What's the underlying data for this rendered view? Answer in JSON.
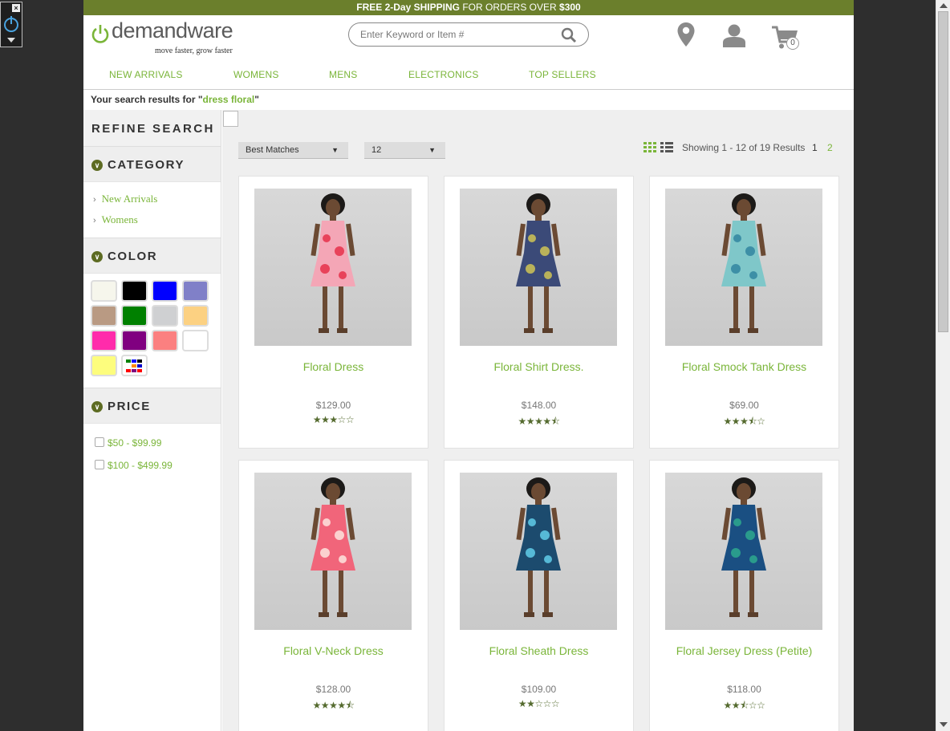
{
  "promo": {
    "pre": "FREE 2-Day",
    "b1": "SHIPPING",
    "post": "FOR ORDERS OVER",
    "amount": "$300"
  },
  "logo": {
    "word": "demandware",
    "tagline": "move faster, grow faster"
  },
  "search": {
    "placeholder": "Enter Keyword or Item #"
  },
  "header": {
    "cart_count": "0"
  },
  "nav": [
    "NEW ARRIVALS",
    "WOMENS",
    "MENS",
    "ELECTRONICS",
    "TOP SELLERS"
  ],
  "results": {
    "prefix": "Your search results for \"",
    "term": "dress floral",
    "suffix": "\""
  },
  "sidebar": {
    "refine": "REFINE SEARCH",
    "category_title": "CATEGORY",
    "categories": [
      "New Arrivals",
      "Womens"
    ],
    "color_title": "COLOR",
    "colors": [
      "#f6f6ec",
      "#000000",
      "#0000ff",
      "#8080c8",
      "#b99a83",
      "#008000",
      "#cfd0d2",
      "#fcd182",
      "#ff2bab",
      "#800080",
      "#fb8080",
      "#ffffff",
      "#fdfd7d",
      "multi"
    ],
    "price_title": "PRICE",
    "prices": [
      "$50 - $99.99",
      "$100 - $499.99"
    ]
  },
  "toolbar": {
    "sort": "Best Matches",
    "per_page": "12",
    "showing": "Showing 1 - 12 of 19 Results",
    "pages": [
      "1",
      "2"
    ]
  },
  "products": [
    {
      "name": "Floral Dress",
      "price": "$129.00",
      "rating": 3,
      "dress": "#f4a6b6",
      "accent": "#e8425a"
    },
    {
      "name": "Floral Shirt Dress.",
      "price": "$148.00",
      "rating": 4.5,
      "dress": "#3b4a78",
      "accent": "#b9b25a"
    },
    {
      "name": "Floral Smock Tank Dress",
      "price": "$69.00",
      "rating": 3.5,
      "dress": "#7fc7c9",
      "accent": "#3d8fa6"
    },
    {
      "name": "Floral V-Neck Dress",
      "price": "$128.00",
      "rating": 4.5,
      "dress": "#f1657a",
      "accent": "#fbd1cf"
    },
    {
      "name": "Floral Sheath Dress",
      "price": "$109.00",
      "rating": 2,
      "dress": "#1c4b6e",
      "accent": "#56b9d6"
    },
    {
      "name": "Floral Jersey Dress (Petite)",
      "price": "$118.00",
      "rating": 2.5,
      "dress": "#1a4f82",
      "accent": "#2a9b8c"
    }
  ]
}
